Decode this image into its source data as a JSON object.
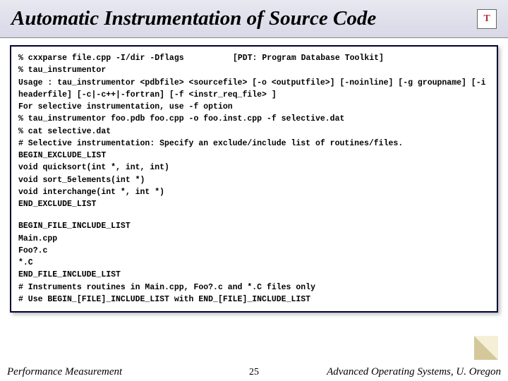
{
  "title": "Automatic Instrumentation of Source Code",
  "logo": "T",
  "annotation": "[PDT: Program Database Toolkit]",
  "code": [
    "% cxxparse file.cpp -I/dir -Dflags",
    "% tau_instrumentor",
    "Usage : tau_instrumentor <pdbfile> <sourcefile> [-o <outputfile>] [-noinline] [-g groupname] [-i headerfile] [-c|-c++|-fortran] [-f <instr_req_file> ]",
    "For selective instrumentation, use -f option",
    "% tau_instrumentor foo.pdb foo.cpp -o foo.inst.cpp -f selective.dat",
    "% cat selective.dat",
    "# Selective instrumentation: Specify an exclude/include list of routines/files.",
    "BEGIN_EXCLUDE_LIST",
    "void quicksort(int *, int, int)",
    "void sort_5elements(int *)",
    "void interchange(int *, int *)",
    "END_EXCLUDE_LIST",
    "",
    "BEGIN_FILE_INCLUDE_LIST",
    "Main.cpp",
    "Foo?.c",
    "*.C",
    "END_FILE_INCLUDE_LIST",
    "# Instruments routines in Main.cpp, Foo?.c and *.C files only",
    "# Use BEGIN_[FILE]_INCLUDE_LIST with END_[FILE]_INCLUDE_LIST"
  ],
  "footer": {
    "left": "Performance Measurement",
    "center": "25",
    "right": "Advanced Operating Systems, U. Oregon"
  }
}
